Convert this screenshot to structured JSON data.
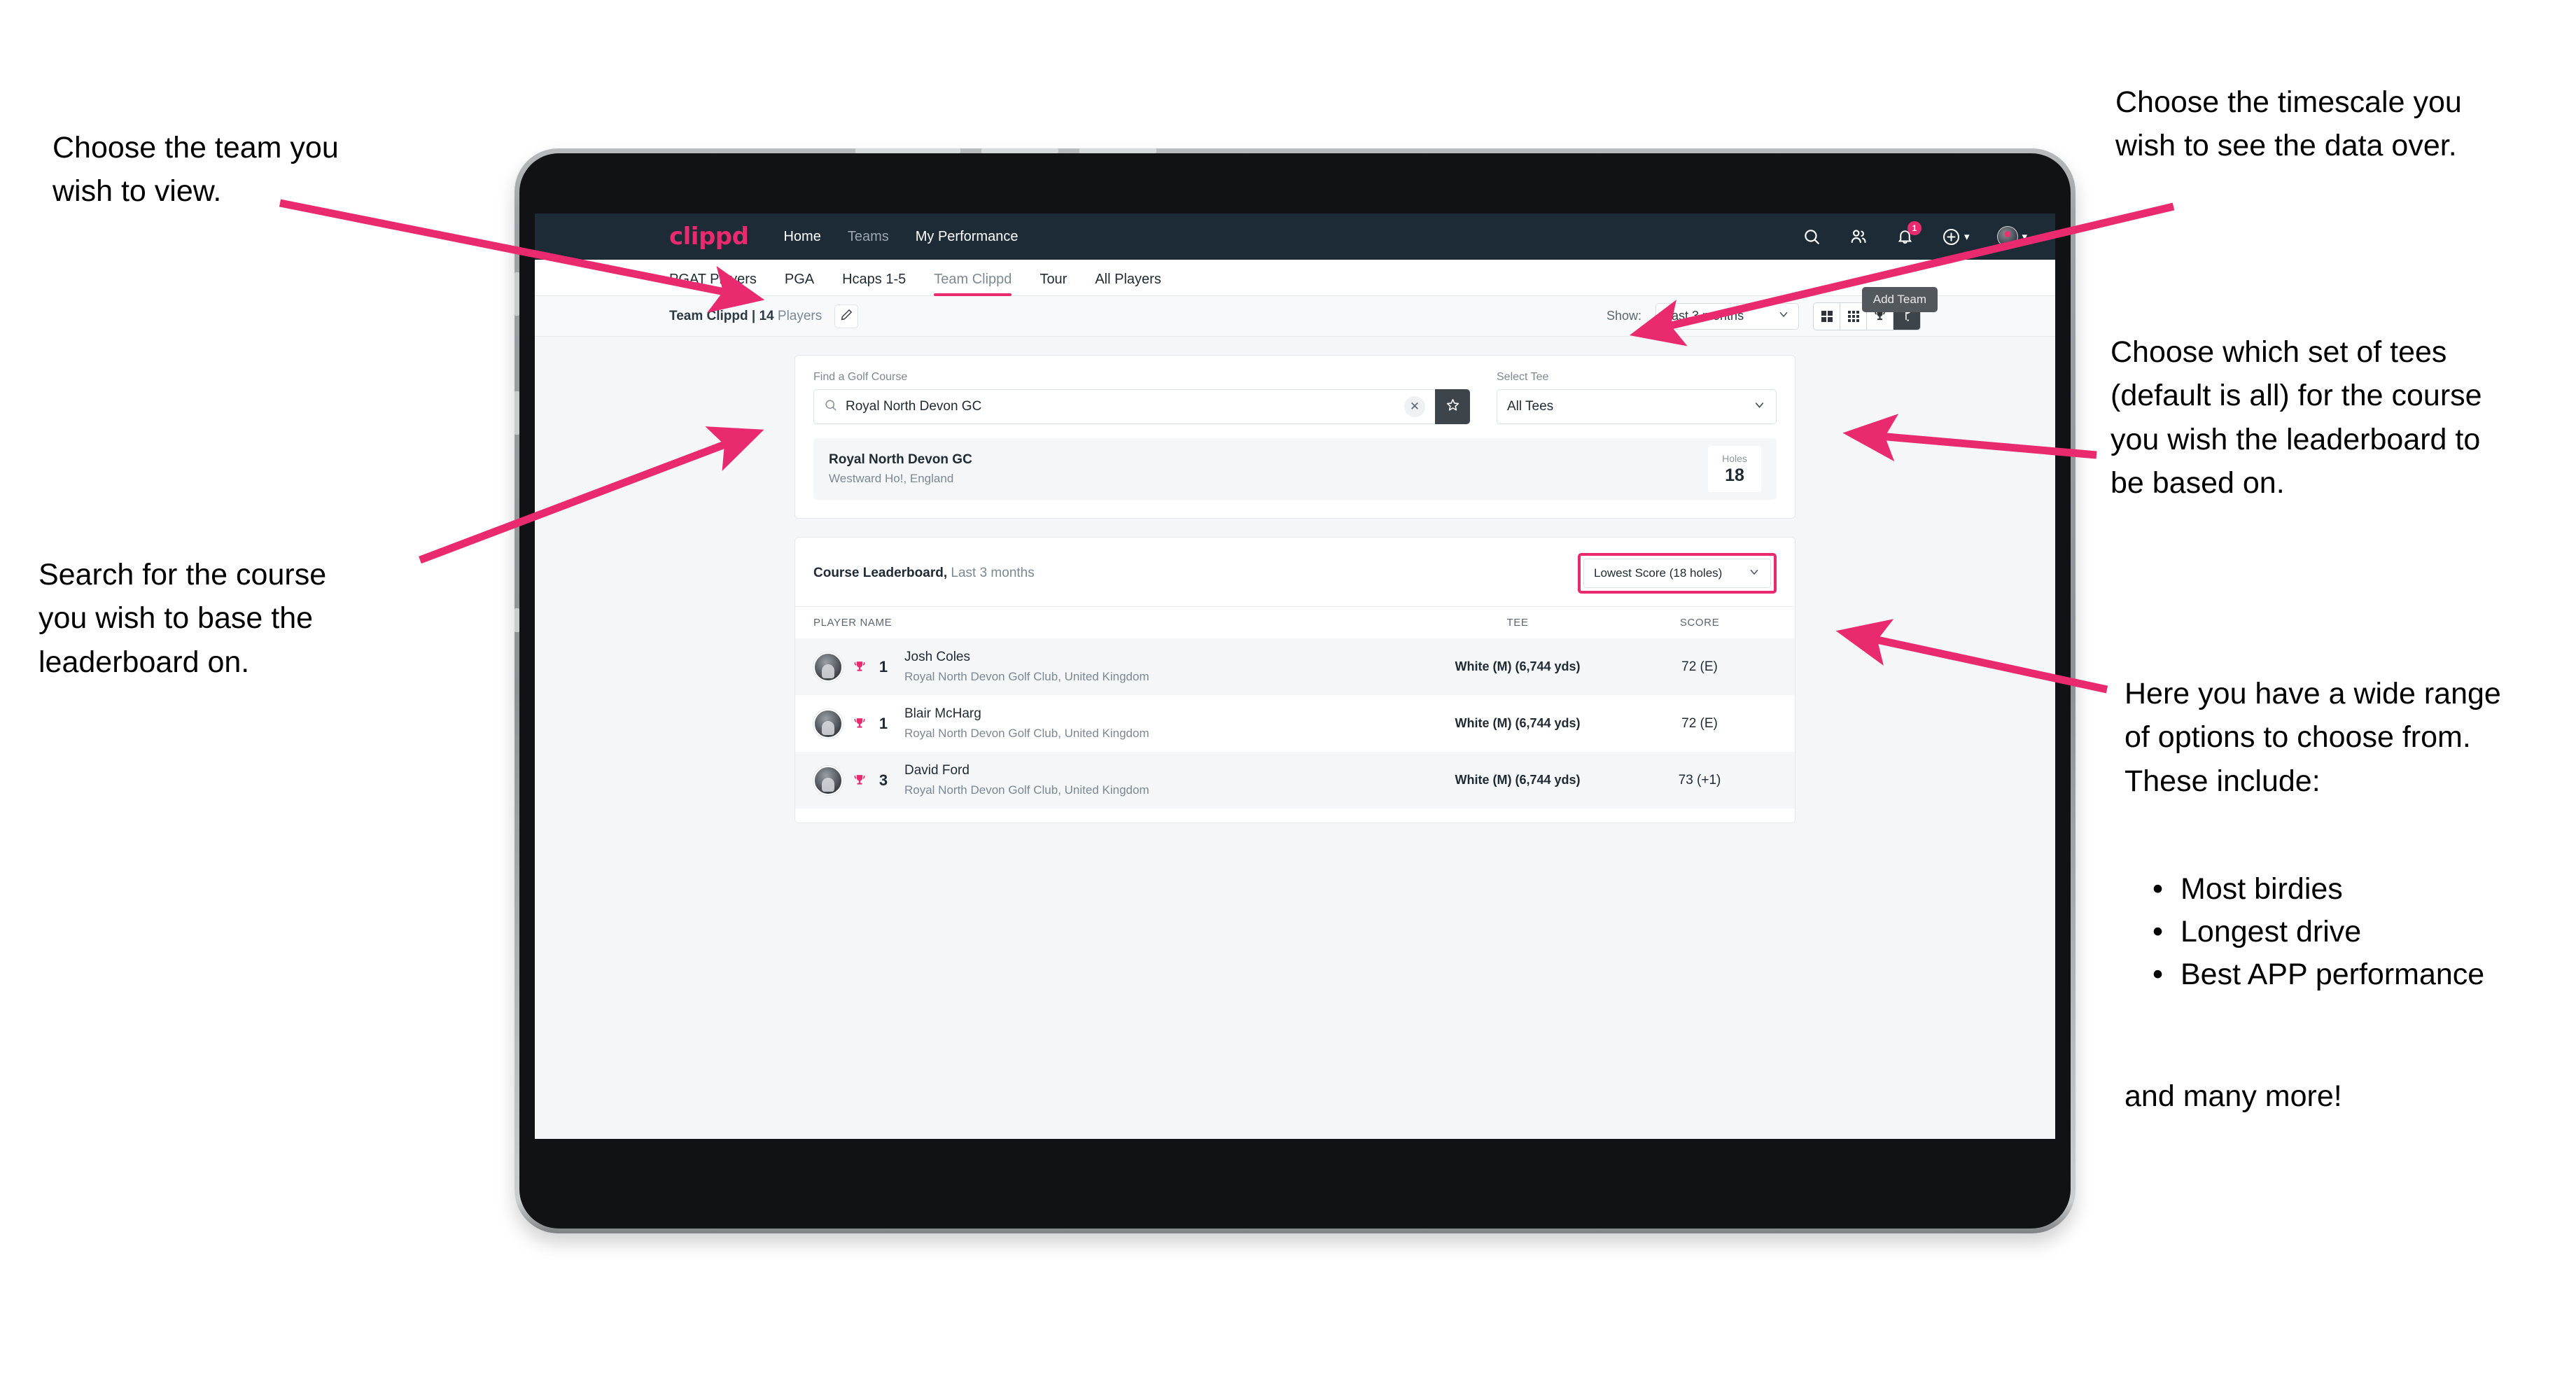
{
  "annotations": {
    "left_top": "Choose the team you\nwish to view.",
    "left_bottom": "Search for the course\nyou wish to base the\nleaderboard on.",
    "right_top": "Choose the timescale you\nwish to see the data over.",
    "right_tees": "Choose which set of tees\n(default is all) for the course\nyou wish the leaderboard to\nbe based on.",
    "right_options": "Here you have a wide range\nof options to choose from.\nThese include:",
    "right_bullets": [
      "Most birdies",
      "Longest drive",
      "Best APP performance"
    ],
    "right_more": "and many more!"
  },
  "topnav": {
    "brand": "clippd",
    "links": [
      {
        "label": "Home",
        "muted": false
      },
      {
        "label": "Teams",
        "muted": true
      },
      {
        "label": "My Performance",
        "muted": false
      }
    ],
    "icons": {
      "search": "search-icon",
      "people": "people-icon",
      "bell": "bell-icon",
      "add": "plus-circle-icon",
      "avatar": "avatar-icon"
    },
    "notification_count": "1"
  },
  "tabs": [
    {
      "label": "PGAT Players",
      "active": false
    },
    {
      "label": "PGA",
      "active": false
    },
    {
      "label": "Hcaps 1-5",
      "active": false
    },
    {
      "label": "Team Clippd",
      "active": true
    },
    {
      "label": "Tour",
      "active": false
    },
    {
      "label": "All Players",
      "active": false
    }
  ],
  "tooltip": {
    "add_team": "Add Team"
  },
  "subheader": {
    "team_name": "Team Clippd | ",
    "team_count": "14",
    "team_suffix": " Players",
    "edit_icon": "pencil-icon",
    "show_label": "Show:",
    "show_value": "Last 3 months",
    "view_toggles": [
      {
        "name": "grid-large-icon",
        "active": false
      },
      {
        "name": "grid-small-icon",
        "active": false
      },
      {
        "name": "trophy-icon",
        "active": false
      },
      {
        "name": "golf-flag-icon",
        "active": true
      }
    ]
  },
  "search_card": {
    "course_label": "Find a Golf Course",
    "course_value": "Royal North Devon GC",
    "course_placeholder": "Find a Golf Course",
    "clear_icon": "close-icon",
    "star_icon": "star-icon",
    "tee_label": "Select Tee",
    "tee_value": "All Tees"
  },
  "course_result": {
    "name": "Royal North Devon GC",
    "location": "Westward Ho!, England",
    "holes_label": "Holes",
    "holes_value": "18"
  },
  "leaderboard": {
    "title": "Course Leaderboard,",
    "subtitle": " Last 3 months",
    "sort_value": "Lowest Score (18 holes)",
    "columns": [
      "PLAYER NAME",
      "TEE",
      "SCORE"
    ],
    "rows": [
      {
        "rank": "1",
        "name": "Josh Coles",
        "club": "Royal North Devon Golf Club, United Kingdom",
        "tee": "White (M) (6,744 yds)",
        "score": "72 (E)"
      },
      {
        "rank": "1",
        "name": "Blair McHarg",
        "club": "Royal North Devon Golf Club, United Kingdom",
        "tee": "White (M) (6,744 yds)",
        "score": "72 (E)"
      },
      {
        "rank": "3",
        "name": "David Ford",
        "club": "Royal North Devon Golf Club, United Kingdom",
        "tee": "White (M) (6,744 yds)",
        "score": "73 (+1)"
      }
    ]
  },
  "colors": {
    "accent": "#ea2a6f",
    "navbar": "#1c2b36",
    "page_bg": "#f4f6f8"
  }
}
